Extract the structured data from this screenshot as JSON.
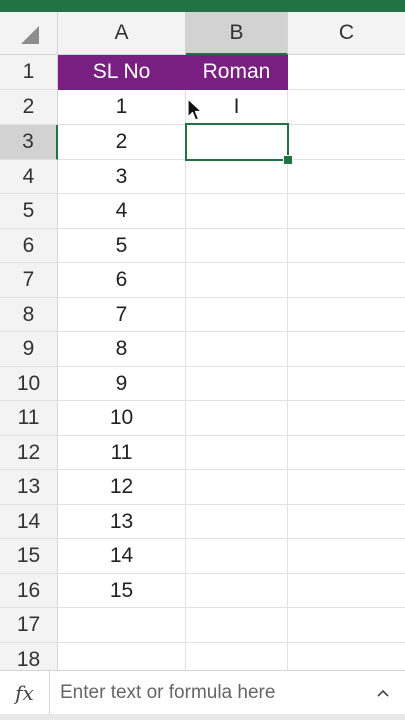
{
  "columns": [
    "A",
    "B",
    "C"
  ],
  "rows": [
    "1",
    "2",
    "3",
    "4",
    "5",
    "6",
    "7",
    "8",
    "9",
    "10",
    "11",
    "12",
    "13",
    "14",
    "15",
    "16",
    "17",
    "18"
  ],
  "table": {
    "header": {
      "col_a": "SL No",
      "col_b": "Roman"
    },
    "sl_values": [
      "1",
      "2",
      "3",
      "4",
      "5",
      "6",
      "7",
      "8",
      "9",
      "10",
      "11",
      "12",
      "13",
      "14",
      "15"
    ],
    "roman_values": [
      "I"
    ]
  },
  "formula_bar": {
    "fx_label": "fx",
    "placeholder": "Enter text or formula here",
    "expand_icon": "chevron-up-icon"
  },
  "colors": {
    "header_fill": "#7a1f82",
    "accent": "#217346"
  }
}
